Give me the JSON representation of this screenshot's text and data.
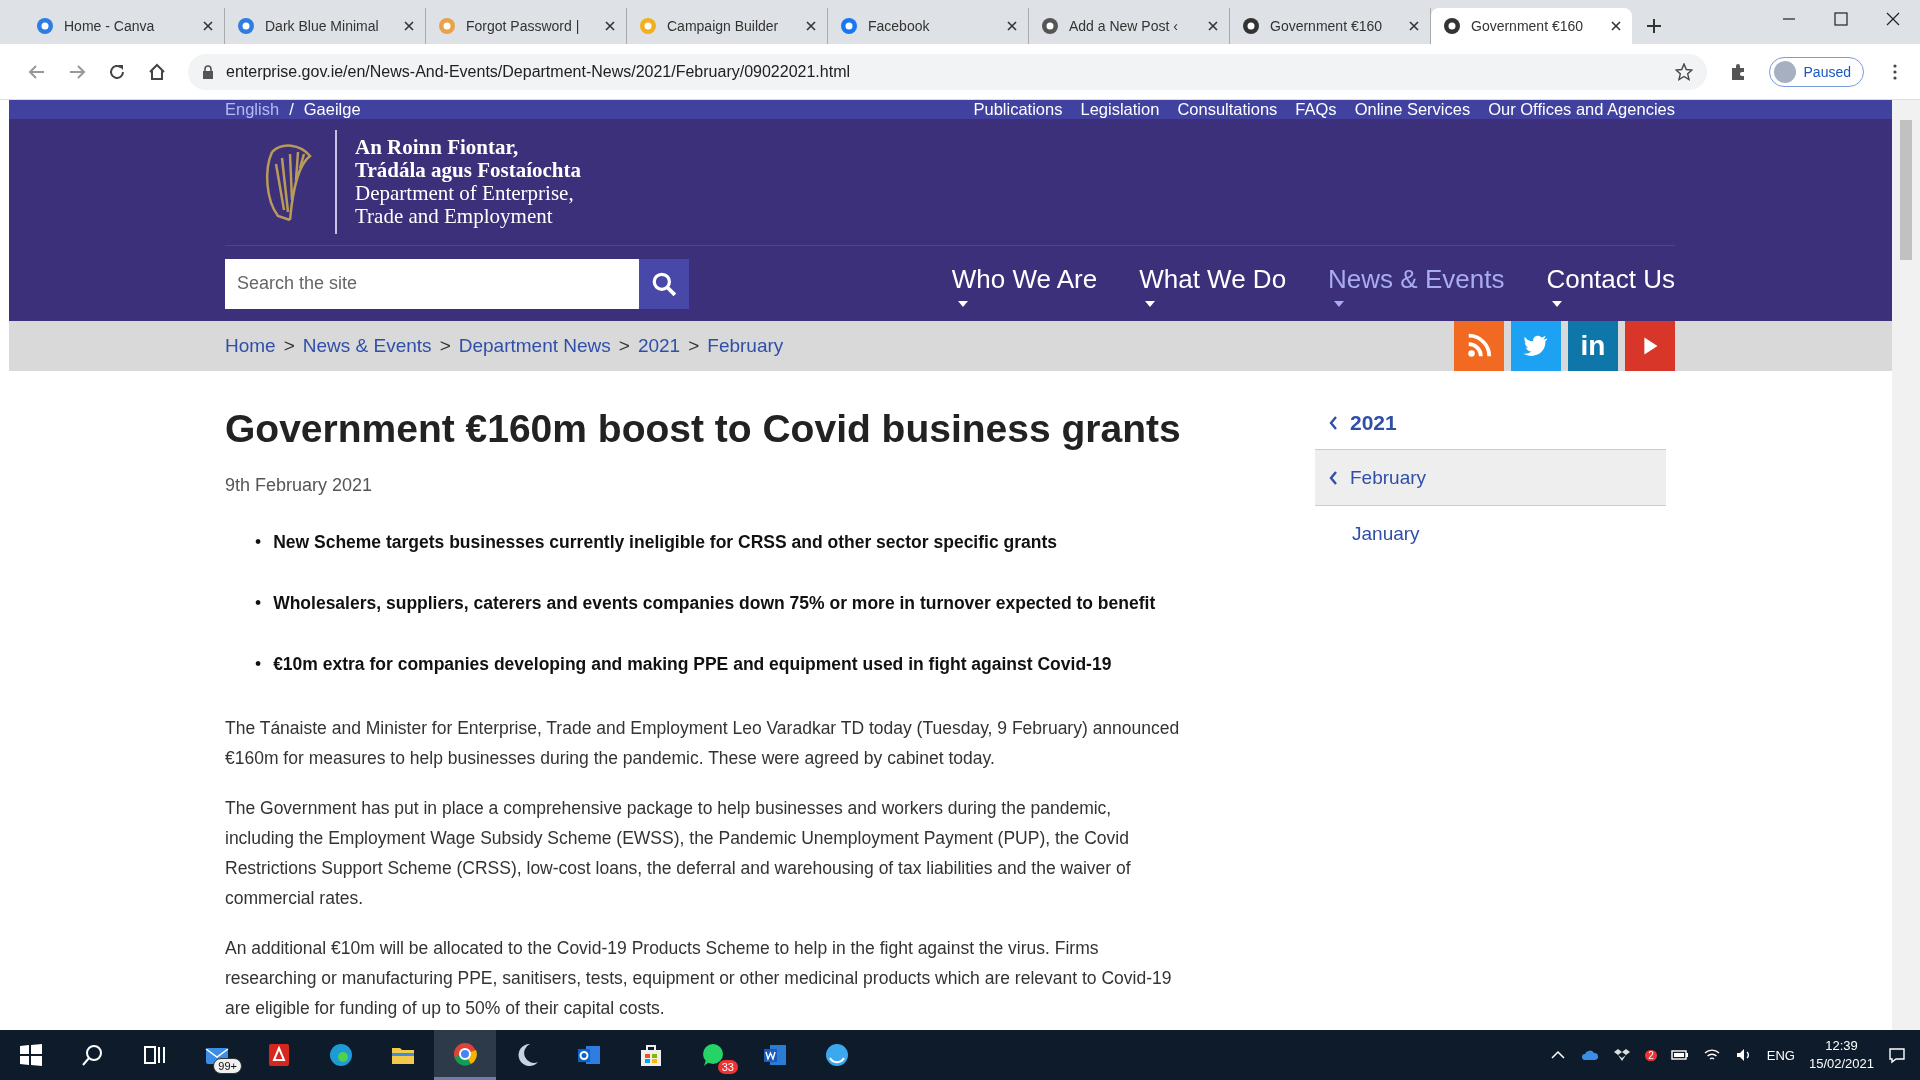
{
  "browser": {
    "tabs": [
      {
        "title": "Home - Canva",
        "color": "#2f7de1",
        "selected": false
      },
      {
        "title": "Dark Blue Minimal",
        "color": "#2f7de1",
        "selected": false
      },
      {
        "title": "Forgot Password |",
        "color": "#e8a24a",
        "selected": false
      },
      {
        "title": "Campaign Builder",
        "color": "#f2b01e",
        "selected": false
      },
      {
        "title": "Facebook",
        "color": "#1877f2",
        "selected": false
      },
      {
        "title": "Add a New Post ‹",
        "color": "#555555",
        "selected": false
      },
      {
        "title": "Government €160",
        "color": "#333333",
        "selected": false
      },
      {
        "title": "Government €160",
        "color": "#333333",
        "selected": true
      }
    ],
    "address": "enterprise.gov.ie/en/News-And-Events/Department-News/2021/February/09022021.html",
    "profile": "Paused"
  },
  "site": {
    "languages": [
      {
        "label": "English",
        "selected": true
      },
      {
        "label": "Gaeilge",
        "selected": false
      }
    ],
    "language_separator": "/",
    "utility_links": [
      "Publications",
      "Legislation",
      "Consultations",
      "FAQs",
      "Online Services",
      "Our Offices and Agencies"
    ],
    "logo_lines": [
      "An Roinn Fiontar,",
      "Trádála agus Fostaíochta",
      "Department of Enterprise,",
      "Trade and Employment"
    ],
    "search": {
      "placeholder": "Search the site"
    },
    "nav": [
      {
        "label": "Who We Are",
        "selected": false
      },
      {
        "label": "What We Do",
        "selected": false
      },
      {
        "label": "News & Events",
        "selected": true
      },
      {
        "label": "Contact Us",
        "selected": false
      }
    ],
    "breadcrumb": [
      "Home",
      "News & Events",
      "Department News",
      "2021",
      "February"
    ],
    "breadcrumb_separator": ">",
    "social": [
      {
        "kind": "rss",
        "color": "#f26a21"
      },
      {
        "kind": "twitter",
        "color": "#1da1f2"
      },
      {
        "kind": "linkedin",
        "color": "#0e76a8",
        "label": "in"
      },
      {
        "kind": "youtube",
        "color": "#d9362a"
      }
    ],
    "article": {
      "title": "Government €160m boost to Covid business grants",
      "date": "9th February 2021",
      "bullet_marker": "•",
      "bullets": [
        "New Scheme targets businesses currently ineligible for CRSS and other sector specific grants",
        "Wholesalers, suppliers, caterers and events companies down 75% or more in turnover expected to benefit",
        "€10m extra for companies developing and making PPE and equipment used in fight against Covid-19"
      ],
      "paragraphs": [
        "The Tánaiste and Minister for Enterprise, Trade and Employment Leo Varadkar TD today (Tuesday, 9 February) announced €160m for measures to help businesses during the pandemic. These were agreed by cabinet today.",
        "The Government has put in place a comprehensive package to help businesses and workers during the pandemic, including the Employment Wage Subsidy Scheme (EWSS), the Pandemic Unemployment Payment (PUP), the Covid Restrictions Support Scheme (CRSS), low-cost loans, the deferral and warehousing of tax liabilities and the waiver of commercial rates.",
        "An additional €10m will be allocated to the Covid-19 Products Scheme to help in the fight against the virus. Firms researching or manufacturing PPE, sanitisers, tests, equipment or other medicinal products which are relevant to Covid-19 are eligible for funding of up to 50% of their capital costs."
      ]
    },
    "sidebar": {
      "year": "2021",
      "months": [
        {
          "label": "February",
          "selected": true
        },
        {
          "label": "January",
          "selected": false
        }
      ]
    }
  },
  "taskbar": {
    "mail_badge": "99+",
    "whatsapp_badge": "33",
    "dropbox_badge": "2",
    "language": "ENG",
    "time": "12:39",
    "date": "15/02/2021"
  }
}
